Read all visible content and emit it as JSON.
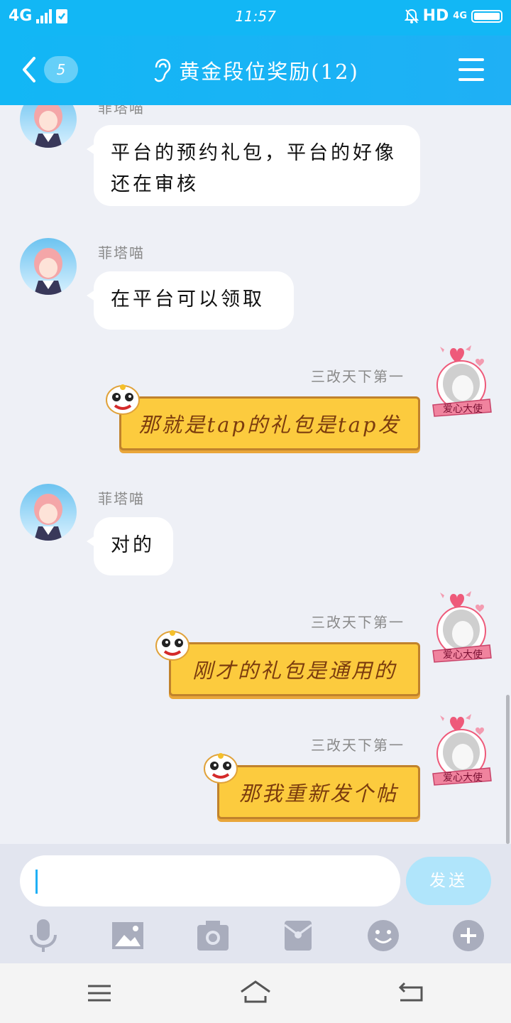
{
  "status_bar": {
    "network": "4G",
    "time": "11:57",
    "hd": "HD",
    "network_right": "4G"
  },
  "nav": {
    "unread": "5",
    "title": "黄金段位奖励(12)"
  },
  "messages": [
    {
      "side": "in",
      "sender": "菲塔喵",
      "text": "平台的预约礼包，平台的好像还在审核"
    },
    {
      "side": "in",
      "sender": "菲塔喵",
      "text": "在平台可以领取"
    },
    {
      "side": "out",
      "sender": "三改天下第一",
      "text": "那就是tap的礼包是tap发",
      "tag": "爱心大使"
    },
    {
      "side": "in",
      "sender": "菲塔喵",
      "text": "对的"
    },
    {
      "side": "out",
      "sender": "三改天下第一",
      "text": "刚才的礼包是通用的",
      "tag": "爱心大使"
    },
    {
      "side": "out",
      "sender": "三改天下第一",
      "text": "那我重新发个帖",
      "tag": "爱心大使"
    }
  ],
  "input": {
    "value": "",
    "send_label": "发送"
  },
  "toolbar": [
    "microphone-icon",
    "image-icon",
    "camera-icon",
    "red-packet-icon",
    "emoji-icon",
    "plus-icon"
  ],
  "colors": {
    "header": "#12b7f5",
    "bubble_in": "#ffffff",
    "bubble_out": "#fccb3e",
    "background": "#eef0f6"
  }
}
